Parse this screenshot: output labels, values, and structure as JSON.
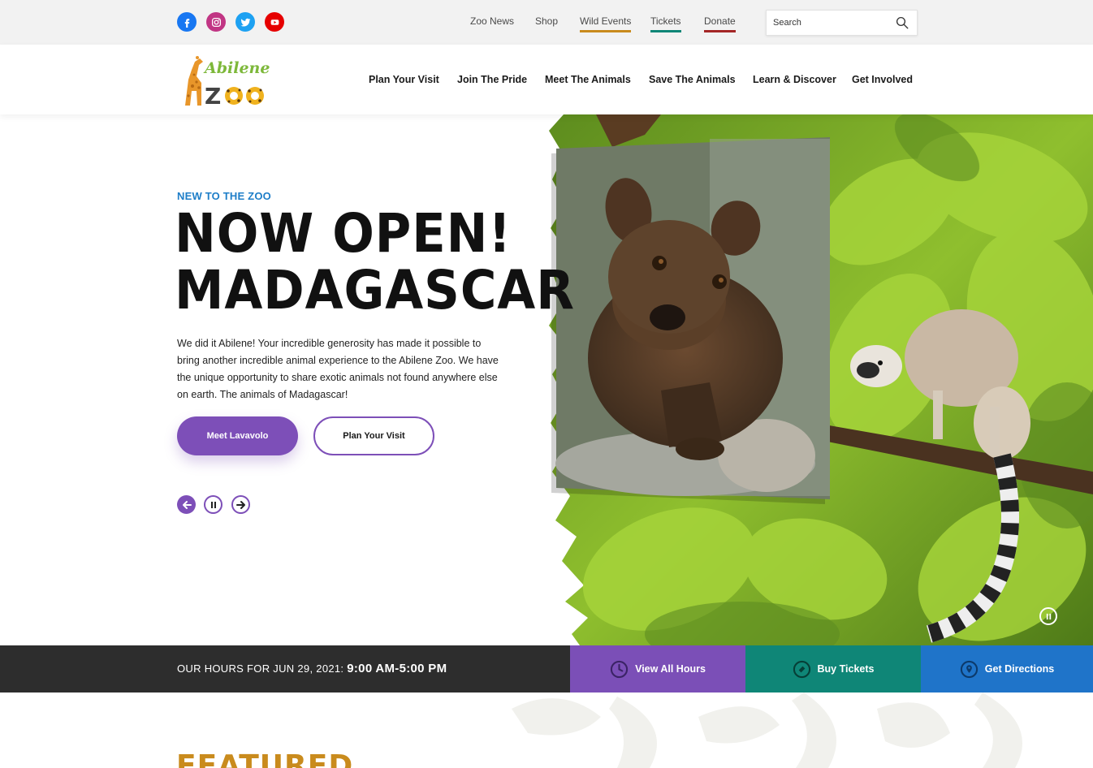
{
  "utility_bar": {
    "social": [
      {
        "name": "facebook-icon",
        "color": "#1877f2"
      },
      {
        "name": "instagram-icon",
        "color": "#c13584"
      },
      {
        "name": "twitter-icon",
        "color": "#1da1f2"
      },
      {
        "name": "youtube-icon",
        "color": "#e60000"
      }
    ],
    "links": [
      {
        "label": "Zoo News",
        "underline": ""
      },
      {
        "label": "Shop",
        "underline": ""
      },
      {
        "label": "Wild Events",
        "underline": "#c98b1d"
      },
      {
        "label": "Tickets",
        "underline": "#0f8677"
      },
      {
        "label": "Donate",
        "underline": "#a42626"
      }
    ],
    "search": {
      "placeholder": "Search"
    }
  },
  "header": {
    "logo": {
      "top_word": "Abilene",
      "bottom_word": "ZOO"
    },
    "nav": [
      "Plan Your Visit",
      "Join The Pride",
      "Meet The Animals",
      "Save The Animals",
      "Learn & Discover",
      "Get Involved"
    ]
  },
  "hero": {
    "eyebrow": "NEW TO THE ZOO",
    "headline_line1": "NOW OPEN!",
    "headline_line2": "MADAGASCAR",
    "body": "We did it Abilene! Your incredible generosity has made it possible to bring another incredible animal experience to the Abilene Zoo. We have the unique opportunity to share exotic animals not found anywhere else on earth. The animals of Madagascar!",
    "primary_button": "Meet Lavavolo",
    "secondary_button": "Plan Your Visit"
  },
  "hours_bar": {
    "label": "OUR HOURS FOR JUN 29, 2021:",
    "hours": "9:00 AM-5:00 PM",
    "view_hours": "View All Hours",
    "buy_tickets": "Buy Tickets",
    "get_directions": "Get Directions"
  },
  "featured": {
    "title": "FEATURED"
  },
  "colors": {
    "purple": "#7d4fb8",
    "teal": "#0f8677",
    "blue": "#1f74c9",
    "gold": "#c98b1d",
    "eyebrow_blue": "#1e7ec8"
  }
}
